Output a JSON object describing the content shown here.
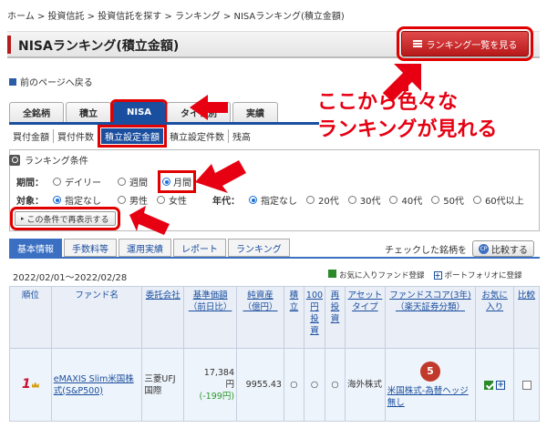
{
  "breadcrumb": [
    "ホーム",
    "投資信託",
    "投資信託を探す",
    "ランキング",
    "NISAランキング(積立金額)"
  ],
  "breadcrumb_separator": ">",
  "page_title": "NISAランキング(積立金額)",
  "ranking_list_button": "ランキング一覧を見る",
  "back_link": "前のページへ戻る",
  "annotation": "ここから色々な\nランキングが見れる",
  "tabs": [
    {
      "label": "全銘柄",
      "active": false
    },
    {
      "label": "積立",
      "active": false
    },
    {
      "label": "NISA",
      "active": true
    },
    {
      "label": "タイプ別",
      "active": false
    },
    {
      "label": "実績",
      "active": false
    }
  ],
  "subtabs": [
    {
      "label": "買付金額",
      "active": false
    },
    {
      "label": "買付件数",
      "active": false
    },
    {
      "label": "積立設定金額",
      "active": true
    },
    {
      "label": "積立設定件数",
      "active": false
    },
    {
      "label": "残高",
      "active": false
    }
  ],
  "conditions": {
    "title": "ランキング条件",
    "period_label": "期間：",
    "period_options": [
      {
        "label": "デイリー",
        "selected": false
      },
      {
        "label": "週間",
        "selected": false
      },
      {
        "label": "月間",
        "selected": true
      }
    ],
    "target_label": "対象：",
    "target_options": [
      {
        "label": "指定なし",
        "selected": true
      },
      {
        "label": "男性",
        "selected": false
      },
      {
        "label": "女性",
        "selected": false
      }
    ],
    "age_label": "年代：",
    "age_options": [
      {
        "label": "指定なし",
        "selected": true
      },
      {
        "label": "20代",
        "selected": false
      },
      {
        "label": "30代",
        "selected": false
      },
      {
        "label": "40代",
        "selected": false
      },
      {
        "label": "50代",
        "selected": false
      },
      {
        "label": "60代以上",
        "selected": false
      }
    ],
    "redisplay_button": "この条件で再表示する"
  },
  "info_tabs": [
    {
      "label": "基本情報",
      "active": true
    },
    {
      "label": "手数料等",
      "active": false
    },
    {
      "label": "運用実績",
      "active": false
    },
    {
      "label": "レポート",
      "active": false
    },
    {
      "label": "ランキング",
      "active": false
    }
  ],
  "compare": {
    "text": "チェックした銘柄を",
    "button": "比較する",
    "icon_text": "CP"
  },
  "date_range": "2022/02/01～2022/02/28",
  "legend": {
    "favorite": "お気に入りファンド登録",
    "portfolio": "ポートフォリオに登録"
  },
  "table": {
    "headers": [
      "順位",
      "ファンド名",
      "委託会社",
      "基準価額（前日比）",
      "純資産（億円）",
      "積立",
      "100円投資",
      "再投資",
      "アセットタイプ",
      "ファンドスコア(3年)（楽天証券分類）",
      "お気に入り",
      "比較"
    ],
    "rows": [
      {
        "rank": "1",
        "fund_name": "eMAXIS Slim米国株式(S&P500)",
        "company": "三菱UFJ国際",
        "nav": "17,384",
        "nav_unit": "円",
        "change": "(-199円)",
        "net_assets": "9955.43",
        "tsumitate": "○",
        "invest100": "○",
        "reinvest": "○",
        "asset_type": "海外株式",
        "score": "5",
        "score_category": "米国株式-為替ヘッジ無し"
      }
    ]
  }
}
